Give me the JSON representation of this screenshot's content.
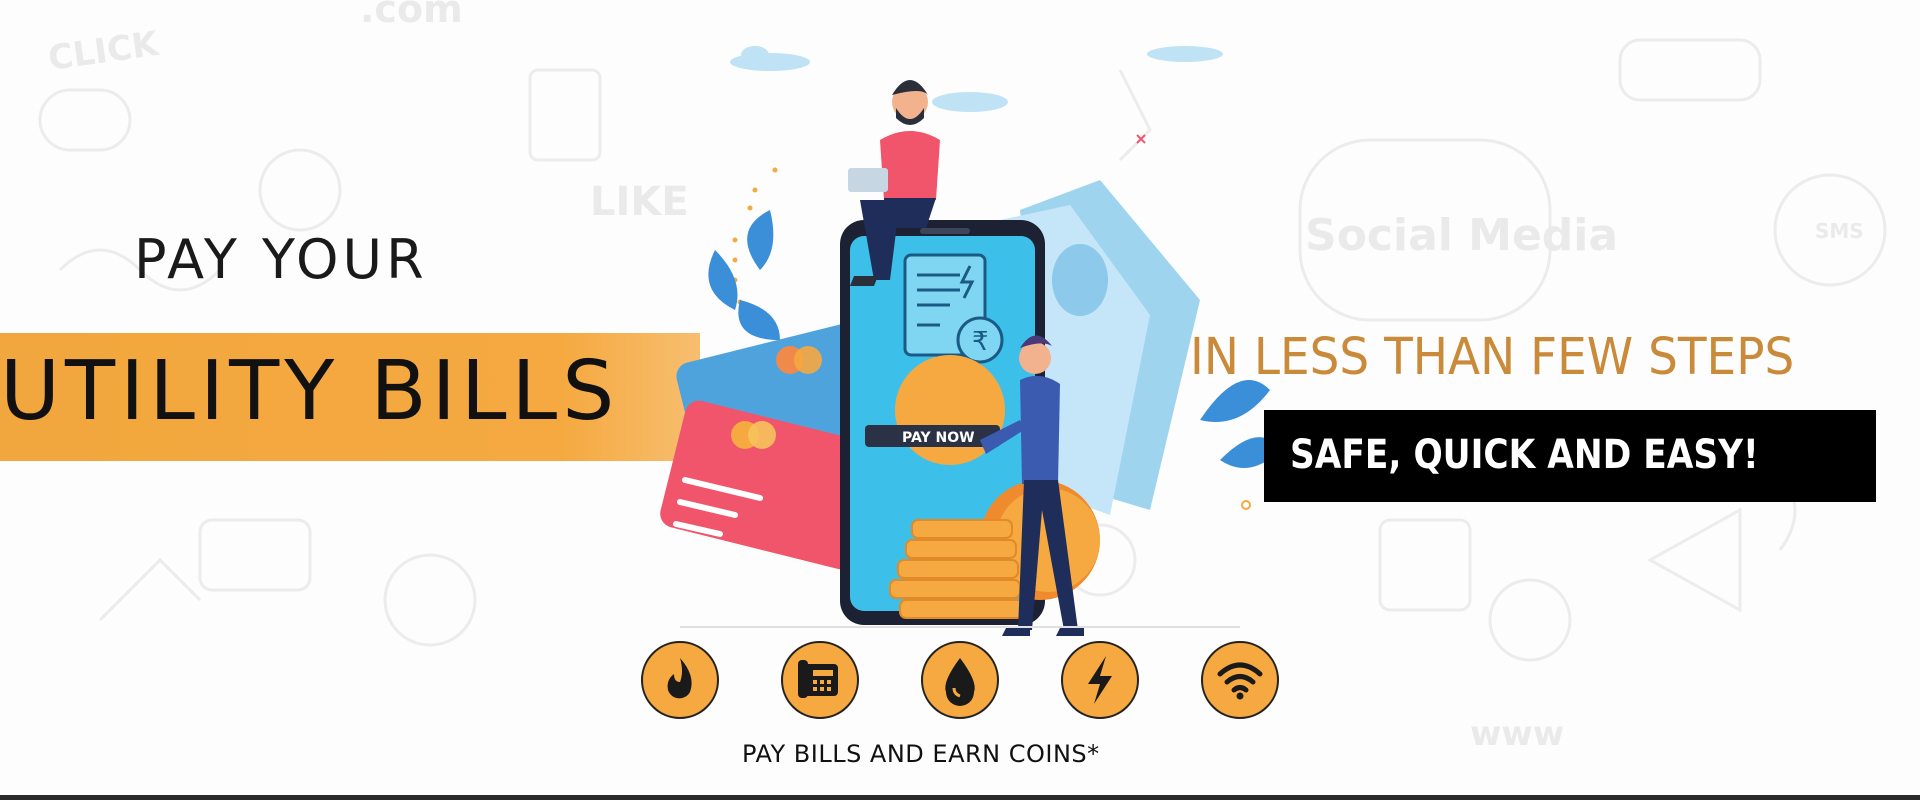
{
  "banner": {
    "headline_top": "PAY YOUR",
    "headline_main": "UTILITY BILLS",
    "tagline": "IN LESS THAN FEW STEPS",
    "highlight": "SAFE, QUICK AND EASY!",
    "pay_button_label": "PAY NOW",
    "footer": "PAY BILLS AND EARN COINS*"
  },
  "utility_icons": [
    "flame-icon",
    "telephone-icon",
    "water-drop-icon",
    "lightning-icon",
    "wifi-icon"
  ],
  "colors": {
    "accent_orange": "#f5a940",
    "tagline_gold": "#c98a3a",
    "highlight_bg": "#000000",
    "icon_circle": "#f5a940",
    "card_red": "#f0556b",
    "card_blue": "#4fa3dd",
    "phone_screen": "#3cc0ea"
  },
  "background_doodles": [
    ".com",
    "CLICK",
    "LIKE",
    "Social Media",
    "SMS",
    "www"
  ]
}
